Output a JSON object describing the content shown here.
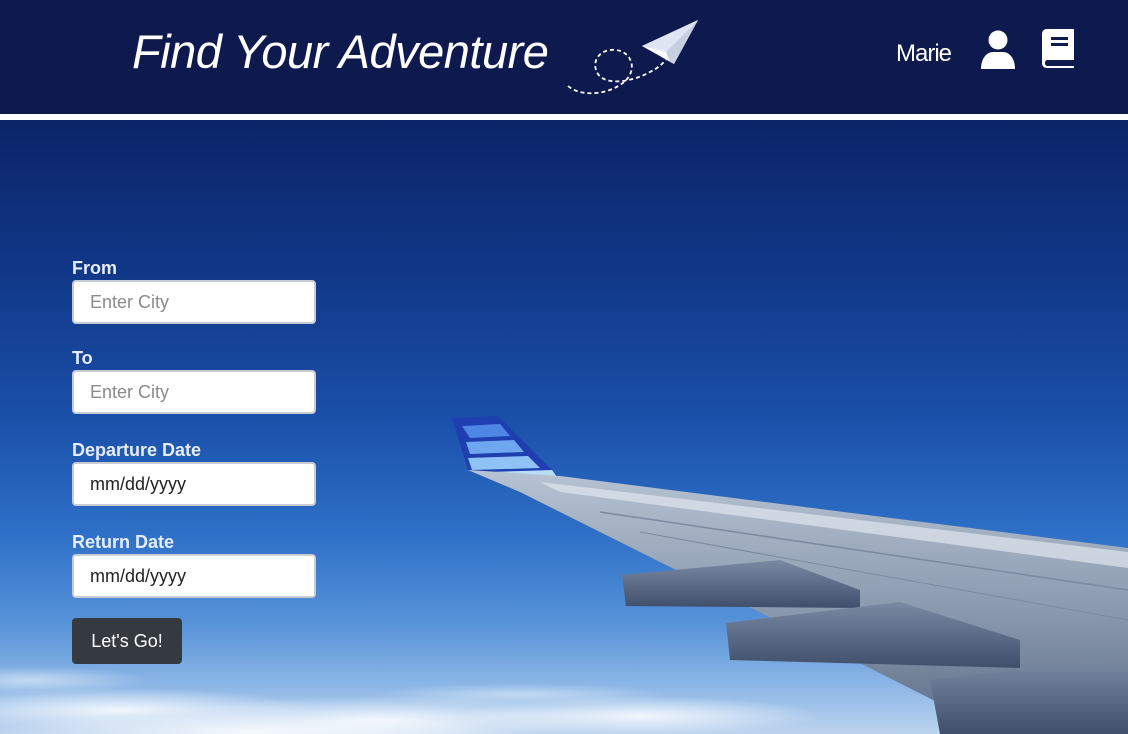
{
  "header": {
    "title": "Find Your Adventure",
    "logo_icon": "paper-plane-icon",
    "username": "Marie",
    "user_icon": "user-icon",
    "book_icon": "book-icon"
  },
  "form": {
    "from": {
      "label": "From",
      "placeholder": "Enter City",
      "value": ""
    },
    "to": {
      "label": "To",
      "placeholder": "Enter City",
      "value": ""
    },
    "departure": {
      "label": "Departure Date",
      "value": "mm/dd/yyyy"
    },
    "return": {
      "label": "Return Date",
      "value": "mm/dd/yyyy"
    },
    "submit_label": "Let's Go!"
  },
  "colors": {
    "navbar": "#0e1a4d",
    "button": "#343a40",
    "sky_top": "#0c2468",
    "sky_bottom": "#bcd4ef"
  }
}
